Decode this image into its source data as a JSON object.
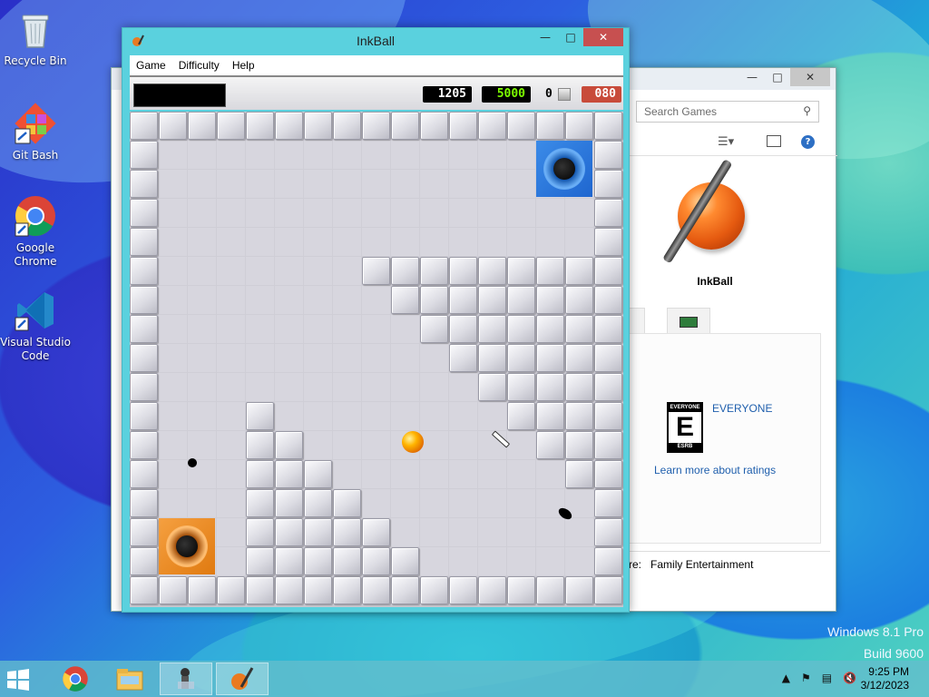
{
  "desktop": {
    "icons": [
      {
        "label": "Recycle Bin",
        "icon": "recycle-bin-icon"
      },
      {
        "label": "Git Bash",
        "icon": "git-bash-icon"
      },
      {
        "label": "Google Chrome",
        "icon": "chrome-icon"
      },
      {
        "label": "Visual Studio Code",
        "icon": "vscode-icon"
      }
    ],
    "watermark": {
      "line1": "Windows 8.1 Pro",
      "line2": "Build 9600"
    }
  },
  "games_explorer": {
    "search_placeholder": "Search Games",
    "game_name": "InkBall",
    "rating": {
      "esrb_top": "EVERYONE",
      "esrb_letter": "E",
      "esrb_bottom": "ESRB",
      "name": "EVERYONE",
      "learn_more": "Learn more about ratings"
    },
    "genre_label": "re:",
    "genre_value": "Family Entertainment"
  },
  "inkball": {
    "title": "InkBall",
    "menu": [
      "Game",
      "Difficulty",
      "Help"
    ],
    "score": "1205",
    "target": "5000",
    "balls_remaining": "0",
    "timer": "080",
    "colors": {
      "window_frame": "#5ad1de",
      "close_button": "#c75050",
      "score_text": "#ffffff",
      "target_text": "#7cfc00",
      "timer_bg": "#c84b3a",
      "hole_blue": "#2a78d8",
      "hole_orange": "#e0801c",
      "ball": "#ffb400"
    }
  },
  "taskbar": {
    "items": [
      "start-button",
      "chrome-icon",
      "file-explorer-icon",
      "games-icon",
      "inkball-icon"
    ],
    "clock_time": "9:25 PM",
    "clock_date": "3/12/2023"
  }
}
